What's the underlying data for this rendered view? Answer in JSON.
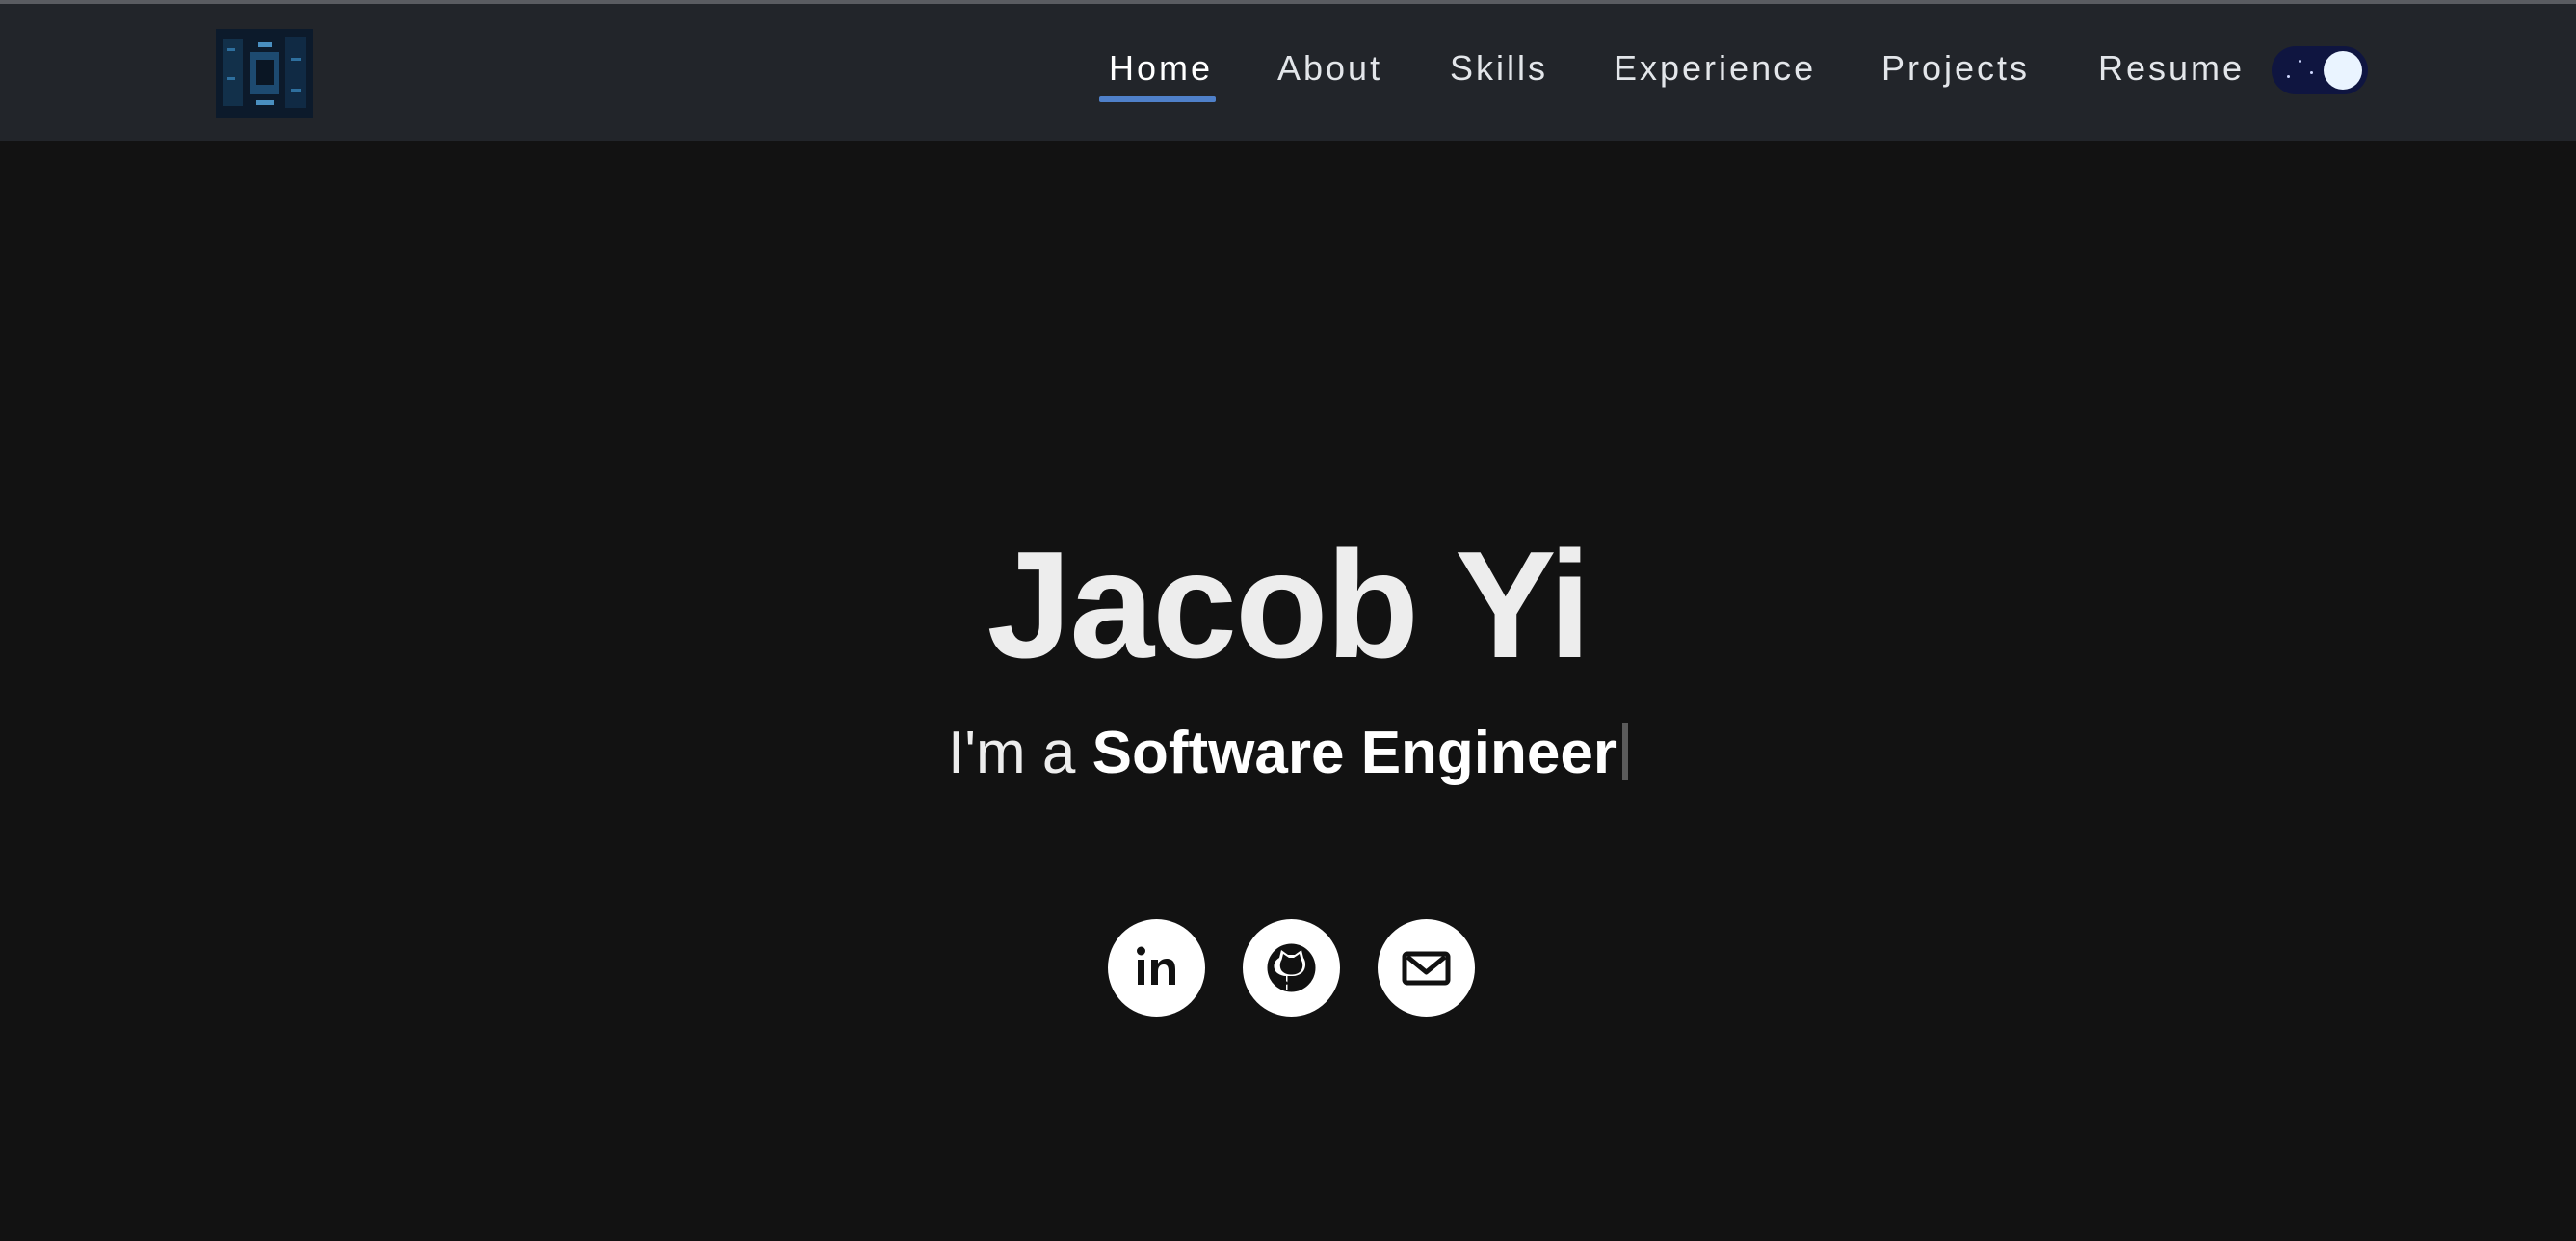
{
  "nav": {
    "logo": "portfolio-logo",
    "items": [
      {
        "label": "Home",
        "active": true
      },
      {
        "label": "About"
      },
      {
        "label": "Skills"
      },
      {
        "label": "Experience"
      },
      {
        "label": "Projects"
      },
      {
        "label": "Resume"
      }
    ],
    "theme_toggle": {
      "state": "dark"
    }
  },
  "hero": {
    "name": "Jacob Yi",
    "intro_prefix": "I'm a ",
    "role": "Software Engineer"
  },
  "social": [
    {
      "icon": "linkedin-icon"
    },
    {
      "icon": "github-icon"
    },
    {
      "icon": "mail-icon"
    }
  ],
  "colors": {
    "background": "#121212",
    "navbar": "#22252a",
    "accent": "#4f80c9",
    "toggle": "#0f1540"
  }
}
